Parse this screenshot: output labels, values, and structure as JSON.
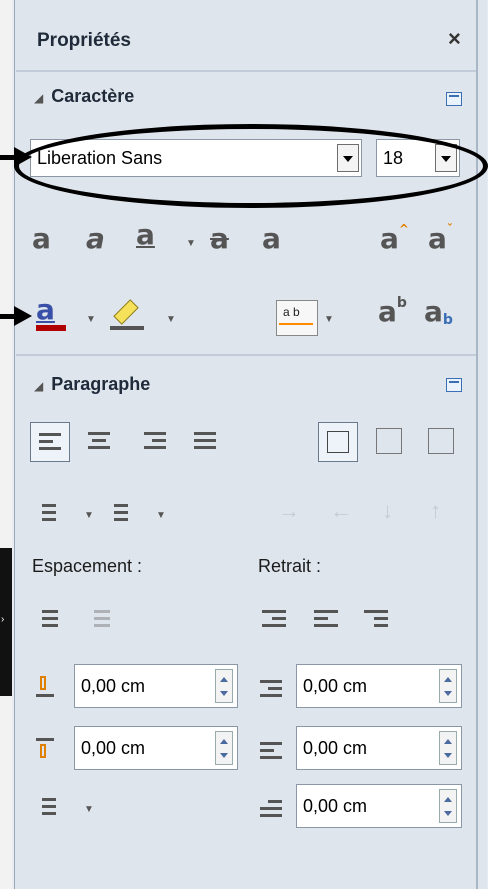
{
  "panel": {
    "title": "Propriétés",
    "close_glyph": "×"
  },
  "caractere": {
    "title": "Caractère",
    "font_name": "Liberation Sans",
    "font_size": "18",
    "font_color": "#b00000",
    "highlight_color": "#f5e15a",
    "icons": [
      "bold-icon",
      "italic-icon",
      "underline-icon",
      "strikethrough-icon",
      "shadow-icon",
      "grow-font-icon",
      "shrink-font-icon",
      "font-color-icon",
      "highlight-icon",
      "character-spacing-icon",
      "superscript-icon",
      "subscript-icon"
    ]
  },
  "paragraphe": {
    "title": "Paragraphe",
    "espacement_label": "Espacement :",
    "retrait_label": "Retrait :",
    "above_spacing": "0,00 cm",
    "below_spacing": "0,00 cm",
    "indent_before": "0,00 cm",
    "indent_after": "0,00 cm",
    "first_line_indent": "0,00 cm"
  },
  "colors": {
    "annotation": "#000000",
    "arrow_accent": "#ff8c00"
  }
}
